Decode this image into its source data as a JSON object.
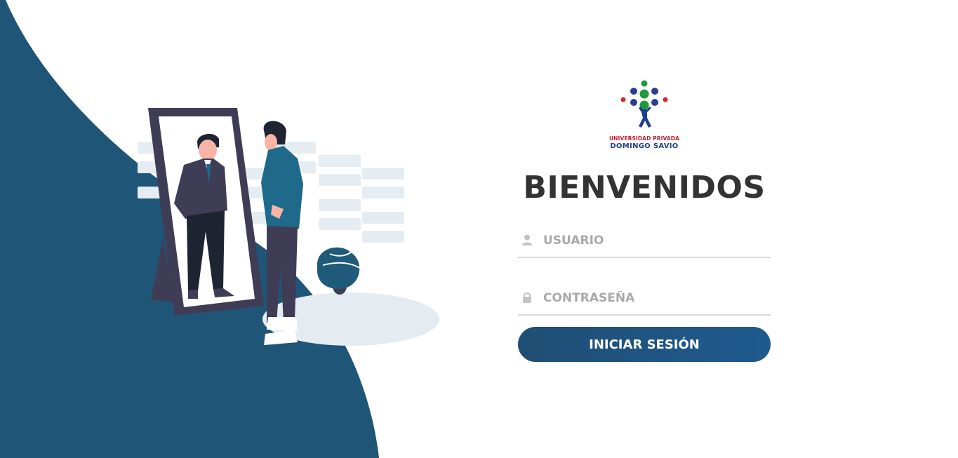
{
  "colors": {
    "wave": "#1f5577",
    "accent": "#1f5a8e",
    "title": "#333333",
    "placeholder": "#a9a9a9",
    "underline": "#d9d9d9"
  },
  "logo": {
    "line1": "UNIVERSIDAD PRIVADA",
    "line2": "DOMINGO SAVIO"
  },
  "welcome_title": "BIENVENIDOS",
  "form": {
    "username": {
      "placeholder": "USUARIO",
      "value": "",
      "icon": "user-icon"
    },
    "password": {
      "placeholder": "CONTRASEÑA",
      "value": "",
      "icon": "lock-icon"
    },
    "submit_label": "INICIAR SESIÓN"
  }
}
